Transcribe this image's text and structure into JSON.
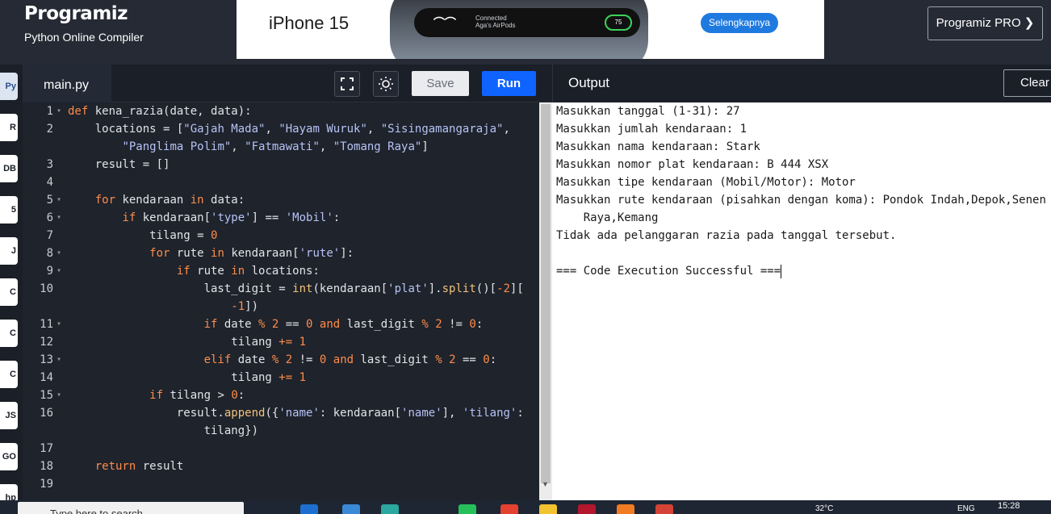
{
  "header": {
    "brand": "Programiz",
    "subtitle": "Python Online Compiler",
    "pro_button": "Programiz PRO ❯"
  },
  "ad": {
    "logo": "iPhone 15",
    "island_text": "Connected\nAga's AirPods",
    "ring_value": "75",
    "button": "Selengkapnya"
  },
  "languages": [
    {
      "icon": "python-icon",
      "label": "Py"
    },
    {
      "icon": "r-icon",
      "label": "R"
    },
    {
      "icon": "sql-icon",
      "label": "DB"
    },
    {
      "icon": "html-icon",
      "label": "5"
    },
    {
      "icon": "java-icon",
      "label": "J"
    },
    {
      "icon": "c-icon",
      "label": "C"
    },
    {
      "icon": "cpp-icon",
      "label": "C"
    },
    {
      "icon": "csharp-icon",
      "label": "C"
    },
    {
      "icon": "js-icon",
      "label": "JS"
    },
    {
      "icon": "go-icon",
      "label": "GO"
    },
    {
      "icon": "php-icon",
      "label": "hp"
    }
  ],
  "editor": {
    "tab": "main.py",
    "save": "Save",
    "run": "Run",
    "lines": [
      {
        "n": "1",
        "fold": true,
        "html": "<span class=\"kw\">def</span> kena_razia(date, data):"
      },
      {
        "n": "2",
        "fold": false,
        "html": "    locations = [<span class=\"st\">\"Gajah Mada\"</span>, <span class=\"st\">\"Hayam Wuruk\"</span>, <span class=\"st\">\"Sisingamangaraja\"</span>,"
      },
      {
        "n": "",
        "fold": false,
        "html": "        <span class=\"st\">\"Panglima Polim\"</span>, <span class=\"st\">\"Fatmawati\"</span>, <span class=\"st\">\"Tomang Raya\"</span>]"
      },
      {
        "n": "3",
        "fold": false,
        "html": "    result = []"
      },
      {
        "n": "4",
        "fold": false,
        "html": ""
      },
      {
        "n": "5",
        "fold": true,
        "html": "    <span class=\"kw\">for</span> kendaraan <span class=\"kw\">in</span> data:"
      },
      {
        "n": "6",
        "fold": true,
        "html": "        <span class=\"kw\">if</span> kendaraan[<span class=\"st\">'type'</span>] == <span class=\"st\">'Mobil'</span>:"
      },
      {
        "n": "7",
        "fold": false,
        "html": "            tilang = <span class=\"nm\">0</span>"
      },
      {
        "n": "8",
        "fold": true,
        "html": "            <span class=\"kw\">for</span> rute <span class=\"kw\">in</span> kendaraan[<span class=\"st\">'rute'</span>]:"
      },
      {
        "n": "9",
        "fold": true,
        "html": "                <span class=\"kw\">if</span> rute <span class=\"kw\">in</span> locations:"
      },
      {
        "n": "10",
        "fold": false,
        "html": "                    last_digit = <span class=\"fn\">int</span>(kendaraan[<span class=\"st\">'plat'</span>].<span class=\"fn\">split</span>()[<span class=\"nm\">-2</span>]["
      },
      {
        "n": "",
        "fold": false,
        "html": "                        <span class=\"nm\">-1</span>])"
      },
      {
        "n": "11",
        "fold": true,
        "html": "                    <span class=\"kw\">if</span> date <span class=\"kw\">%</span> <span class=\"nm\">2</span> == <span class=\"nm\">0</span> <span class=\"kw\">and</span> last_digit <span class=\"kw\">%</span> <span class=\"nm\">2</span> != <span class=\"nm\">0</span>:"
      },
      {
        "n": "12",
        "fold": false,
        "html": "                        tilang <span class=\"kw\">+=</span> <span class=\"nm\">1</span>"
      },
      {
        "n": "13",
        "fold": true,
        "html": "                    <span class=\"kw\">elif</span> date <span class=\"kw\">%</span> <span class=\"nm\">2</span> != <span class=\"nm\">0</span> <span class=\"kw\">and</span> last_digit <span class=\"kw\">%</span> <span class=\"nm\">2</span> == <span class=\"nm\">0</span>:"
      },
      {
        "n": "14",
        "fold": false,
        "html": "                        tilang <span class=\"kw\">+=</span> <span class=\"nm\">1</span>"
      },
      {
        "n": "15",
        "fold": true,
        "html": "            <span class=\"kw\">if</span> tilang > <span class=\"nm\">0</span>:"
      },
      {
        "n": "16",
        "fold": false,
        "html": "                result.<span class=\"fn\">append</span>({<span class=\"st\">'name'</span>: kendaraan[<span class=\"st\">'name'</span>], <span class=\"st\">'tilang'</span>:"
      },
      {
        "n": "",
        "fold": false,
        "html": "                    tilang})"
      },
      {
        "n": "17",
        "fold": false,
        "html": ""
      },
      {
        "n": "18",
        "fold": false,
        "html": "    <span class=\"kw\">return</span> result"
      },
      {
        "n": "19",
        "fold": false,
        "html": ""
      }
    ]
  },
  "output": {
    "title": "Output",
    "clear": "Clear",
    "lines": [
      "Masukkan tanggal (1-31): 27",
      "Masukkan jumlah kendaraan: 1",
      "Masukkan nama kendaraan: Stark",
      "Masukkan nomor plat kendaraan: B 444 XSX",
      "Masukkan tipe kendaraan (Mobil/Motor): Motor",
      "Masukkan rute kendaraan (pisahkan dengan koma): Pondok Indah,Depok,Senen",
      "    Raya,Kemang",
      "Tidak ada pelanggaran razia pada tanggal tersebut.",
      "",
      "=== Code Execution Successful ==="
    ]
  },
  "taskbar": {
    "search_placeholder": "Type here to search",
    "weather": "32°C",
    "lang": "ENG",
    "time": "15:28"
  }
}
